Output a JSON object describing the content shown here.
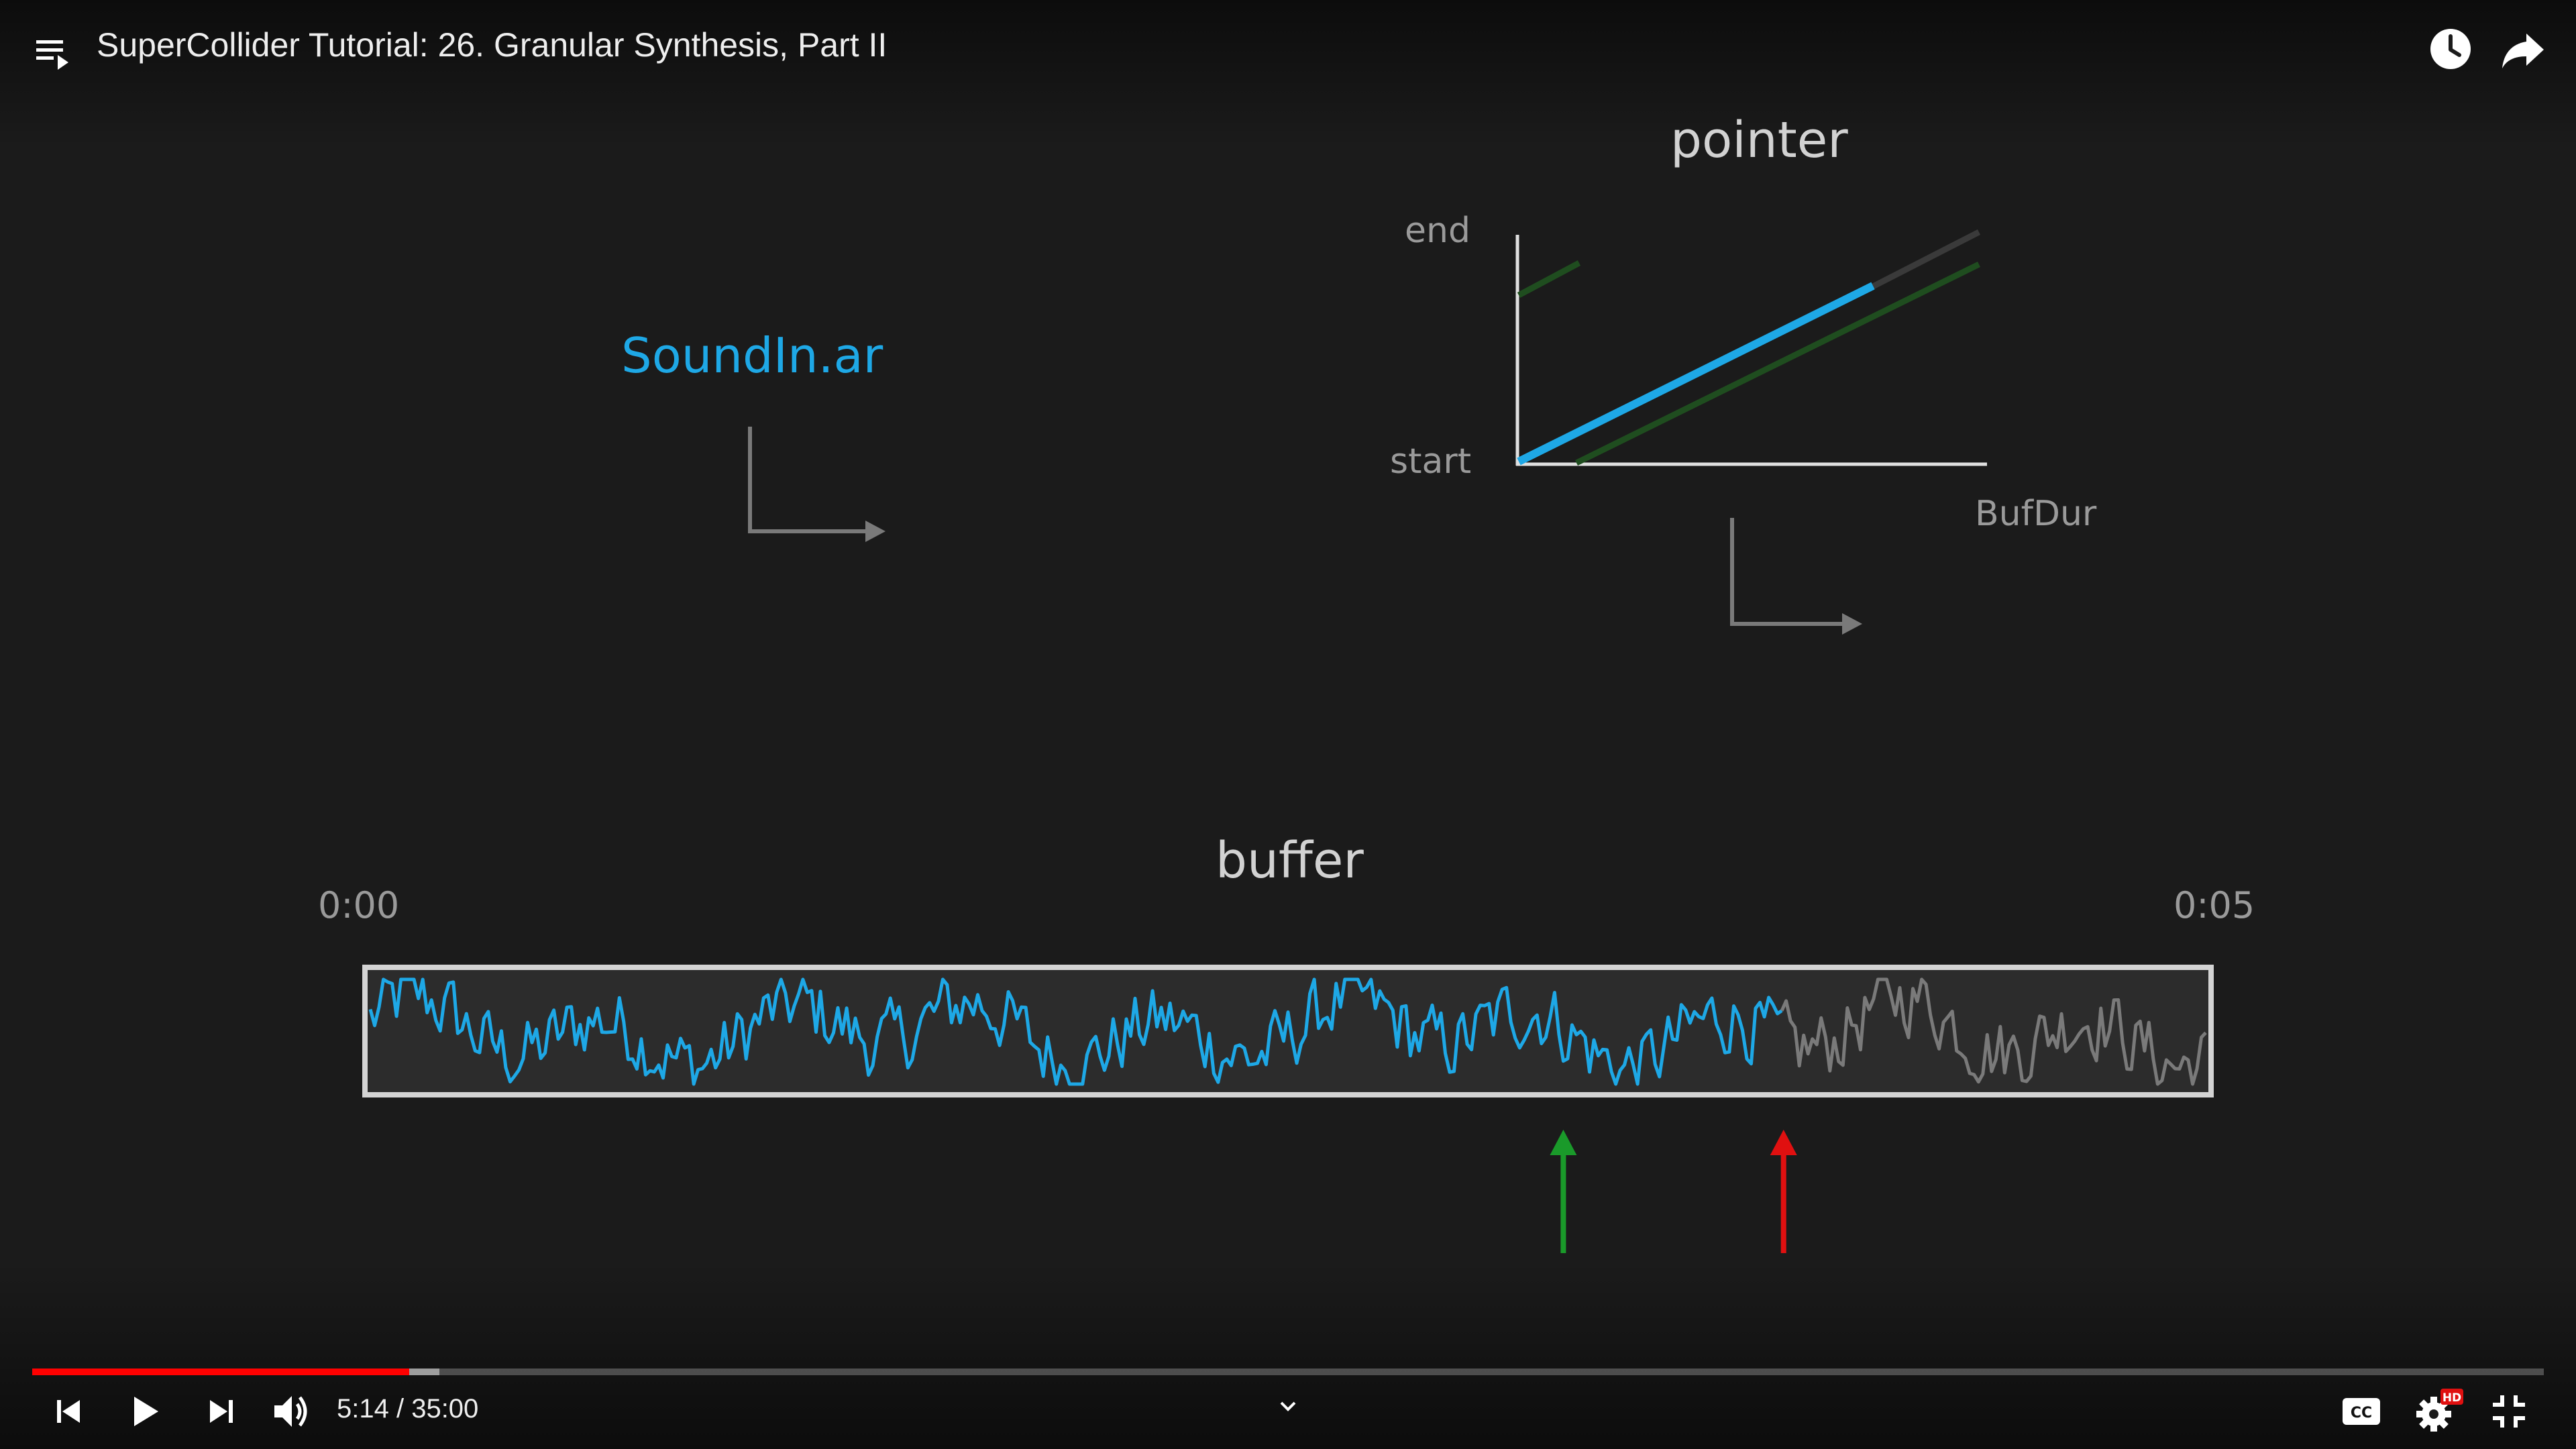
{
  "header": {
    "title": "SuperCollider Tutorial: 26. Granular Synthesis, Part II",
    "icons": [
      "playlist-icon",
      "watch-later-icon",
      "share-icon"
    ]
  },
  "slide": {
    "pointer_title": "pointer",
    "soundin_label": "SoundIn.ar",
    "graph_end_label": "end",
    "graph_start_label": "start",
    "graph_x_label": "BufDur",
    "buffer_title": "buffer",
    "buffer_start_time": "0:00",
    "buffer_end_time": "0:05",
    "colors": {
      "soundin": "#1ea8e6",
      "pointer_line": "#1ea8e6",
      "green_line": "#1f4d1f",
      "grey_line": "#3a3a3a",
      "waveform_recorded": "#1ea8e6",
      "waveform_pending": "#7a7a7a",
      "green_arrow": "#1a9a2a",
      "red_arrow": "#e01010"
    },
    "buffer_recorded_fraction": 0.77,
    "green_marker_fraction": 0.65,
    "red_marker_fraction": 0.77
  },
  "player": {
    "current_time": "5:14",
    "separator": " / ",
    "duration": "35:00",
    "played_fraction": 0.15,
    "buffered_fraction": 0.162,
    "icons": [
      "previous-icon",
      "play-icon",
      "next-icon",
      "volume-icon",
      "chevron-down-icon",
      "captions-icon",
      "settings-icon",
      "exit-fullscreen-icon"
    ],
    "quality_badge": "HD",
    "captions_label": "CC"
  }
}
